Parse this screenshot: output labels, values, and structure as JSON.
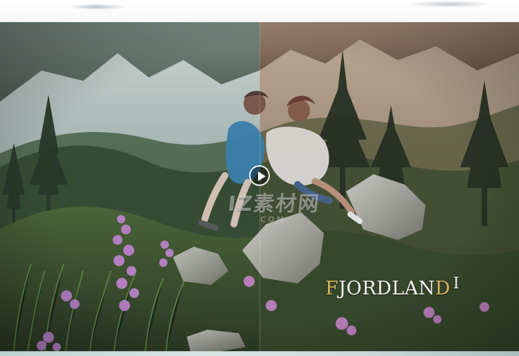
{
  "brand": {
    "text": "FJORDLAND",
    "first_letter": "F",
    "middle": "JORDLAN",
    "last_letter": "D",
    "tail": "I"
  },
  "watermark": {
    "main": "IZ素材网",
    "sub": "COM"
  },
  "icons": {
    "play": "play-icon"
  },
  "colors": {
    "gold": "#d7b65c"
  }
}
